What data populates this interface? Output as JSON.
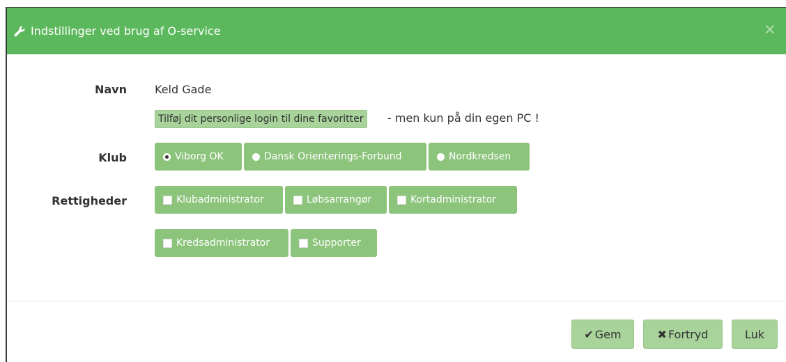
{
  "dialog": {
    "title": "Indstillinger ved brug af O-service",
    "close_symbol": "×",
    "title_icon": "wrench-icon"
  },
  "form": {
    "name_label": "Navn",
    "name_value": "Keld Gade",
    "favorites_button": "Tilføj dit personlige login til dine favoritter",
    "favorites_note": "- men kun på din egen PC !",
    "club_label": "Klub",
    "clubs": [
      {
        "label": "Viborg OK",
        "checked": true
      },
      {
        "label": "Dansk Orienterings-Forbund",
        "checked": false
      },
      {
        "label": "Nordkredsen",
        "checked": false
      }
    ],
    "rights_label": "Rettigheder",
    "rights": [
      {
        "label": "Klubadministrator",
        "checked": false
      },
      {
        "label": "Løbsarrangør",
        "checked": false
      },
      {
        "label": "Kortadministrator",
        "checked": false
      },
      {
        "label": "Kredsadministrator",
        "checked": false
      },
      {
        "label": "Supporter",
        "checked": false
      }
    ]
  },
  "footer": {
    "save": {
      "icon": "✔",
      "label": "Gem"
    },
    "cancel": {
      "icon": "✖",
      "label": "Fortryd"
    },
    "close": {
      "label": "Luk"
    }
  },
  "colors": {
    "header": "#5cb85c",
    "option_button": "#8cc47c",
    "footer_button": "#a8d39a"
  }
}
